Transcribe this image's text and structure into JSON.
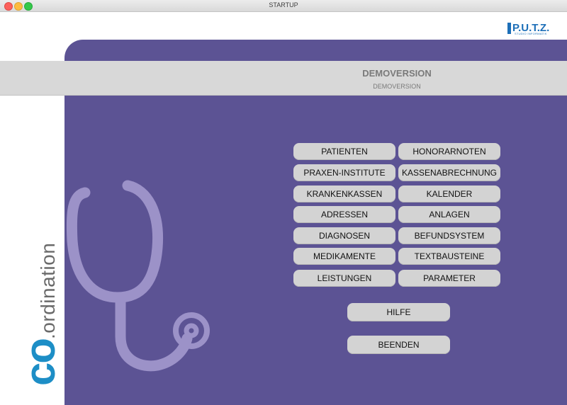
{
  "window": {
    "title": "STARTUP"
  },
  "logo": {
    "text": "P.U.T.Z.",
    "sub": "STUDIO INFORMATIK"
  },
  "banner": {
    "title": "DEMOVERSION",
    "subtitle": "DEMOVERSION"
  },
  "brand": {
    "co": "co",
    "rest": ".ordination"
  },
  "menu": {
    "left": [
      "PATIENTEN",
      "PRAXEN-INSTITUTE",
      "KRANKENKASSEN",
      "ADRESSEN",
      "DIAGNOSEN",
      "MEDIKAMENTE",
      "LEISTUNGEN"
    ],
    "right": [
      "HONORARNOTEN",
      "KASSENABRECHNUNG",
      "KALENDER",
      "ANLAGEN",
      "BEFUNDSYSTEM",
      "TEXTBAUSTEINE",
      "PARAMETER"
    ]
  },
  "actions": {
    "help": "HILFE",
    "quit": "BEENDEN"
  },
  "colors": {
    "panel": "#5c5394",
    "button": "#d3d3d3",
    "brand": "#1d8ec6",
    "stethoscope": "#9c92c8"
  }
}
